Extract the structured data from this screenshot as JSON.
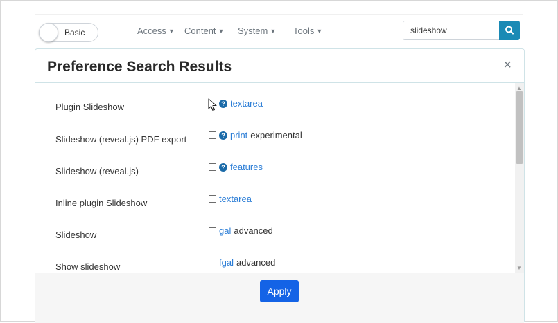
{
  "navbar": {
    "mode_toggle_label": "Basic",
    "menus": [
      {
        "label": "Access"
      },
      {
        "label": "Content"
      },
      {
        "label": "System"
      },
      {
        "label": "Tools"
      }
    ],
    "search_value": "slideshow",
    "search_icon": "search-icon"
  },
  "modal": {
    "title": "Preference Search Results",
    "close_label": "×",
    "rows": [
      {
        "label": "Plugin Slideshow",
        "link": "textarea",
        "help": true,
        "extra": ""
      },
      {
        "label": "Slideshow (reveal.js) PDF export",
        "link": "print",
        "help": true,
        "extra": "experimental"
      },
      {
        "label": "Slideshow (reveal.js)",
        "link": "features",
        "help": true,
        "extra": ""
      },
      {
        "label": "Inline plugin Slideshow",
        "link": "textarea",
        "help": false,
        "extra": ""
      },
      {
        "label": "Slideshow",
        "link": "gal",
        "help": false,
        "extra": "advanced"
      },
      {
        "label": "Show slideshow",
        "link": "fgal",
        "help": false,
        "extra": "advanced"
      }
    ],
    "apply_label": "Apply"
  },
  "colors": {
    "accent": "#1a8ab5",
    "apply": "#1463e6",
    "link": "#2b7dd6",
    "help": "#1a6aa8"
  }
}
